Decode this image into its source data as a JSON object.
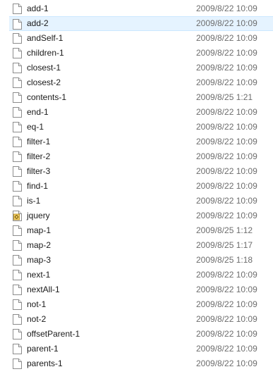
{
  "file_list": {
    "selected_index": 1,
    "rows": [
      {
        "name": "add-1",
        "date": "2009/8/22 10:09",
        "icon": "blank-file-icon"
      },
      {
        "name": "add-2",
        "date": "2009/8/22 10:09",
        "icon": "blank-file-icon"
      },
      {
        "name": "andSelf-1",
        "date": "2009/8/22 10:09",
        "icon": "blank-file-icon"
      },
      {
        "name": "children-1",
        "date": "2009/8/22 10:09",
        "icon": "blank-file-icon"
      },
      {
        "name": "closest-1",
        "date": "2009/8/22 10:09",
        "icon": "blank-file-icon"
      },
      {
        "name": "closest-2",
        "date": "2009/8/22 10:09",
        "icon": "blank-file-icon"
      },
      {
        "name": "contents-1",
        "date": "2009/8/25 1:21",
        "icon": "blank-file-icon"
      },
      {
        "name": "end-1",
        "date": "2009/8/22 10:09",
        "icon": "blank-file-icon"
      },
      {
        "name": "eq-1",
        "date": "2009/8/22 10:09",
        "icon": "blank-file-icon"
      },
      {
        "name": "filter-1",
        "date": "2009/8/22 10:09",
        "icon": "blank-file-icon"
      },
      {
        "name": "filter-2",
        "date": "2009/8/22 10:09",
        "icon": "blank-file-icon"
      },
      {
        "name": "filter-3",
        "date": "2009/8/22 10:09",
        "icon": "blank-file-icon"
      },
      {
        "name": "find-1",
        "date": "2009/8/22 10:09",
        "icon": "blank-file-icon"
      },
      {
        "name": "is-1",
        "date": "2009/8/22 10:09",
        "icon": "blank-file-icon"
      },
      {
        "name": "jquery",
        "date": "2009/8/22 10:09",
        "icon": "script-file-icon"
      },
      {
        "name": "map-1",
        "date": "2009/8/25 1:12",
        "icon": "blank-file-icon"
      },
      {
        "name": "map-2",
        "date": "2009/8/25 1:17",
        "icon": "blank-file-icon"
      },
      {
        "name": "map-3",
        "date": "2009/8/25 1:18",
        "icon": "blank-file-icon"
      },
      {
        "name": "next-1",
        "date": "2009/8/22 10:09",
        "icon": "blank-file-icon"
      },
      {
        "name": "nextAll-1",
        "date": "2009/8/22 10:09",
        "icon": "blank-file-icon"
      },
      {
        "name": "not-1",
        "date": "2009/8/22 10:09",
        "icon": "blank-file-icon"
      },
      {
        "name": "not-2",
        "date": "2009/8/22 10:09",
        "icon": "blank-file-icon"
      },
      {
        "name": "offsetParent-1",
        "date": "2009/8/22 10:09",
        "icon": "blank-file-icon"
      },
      {
        "name": "parent-1",
        "date": "2009/8/22 10:09",
        "icon": "blank-file-icon"
      },
      {
        "name": "parents-1",
        "date": "2009/8/22 10:09",
        "icon": "blank-file-icon"
      }
    ]
  },
  "colors": {
    "selection_bg": "#e5f3ff",
    "selection_border": "#cce8ff",
    "name_text": "#1a1a1a",
    "date_text": "#6d6d6d"
  }
}
